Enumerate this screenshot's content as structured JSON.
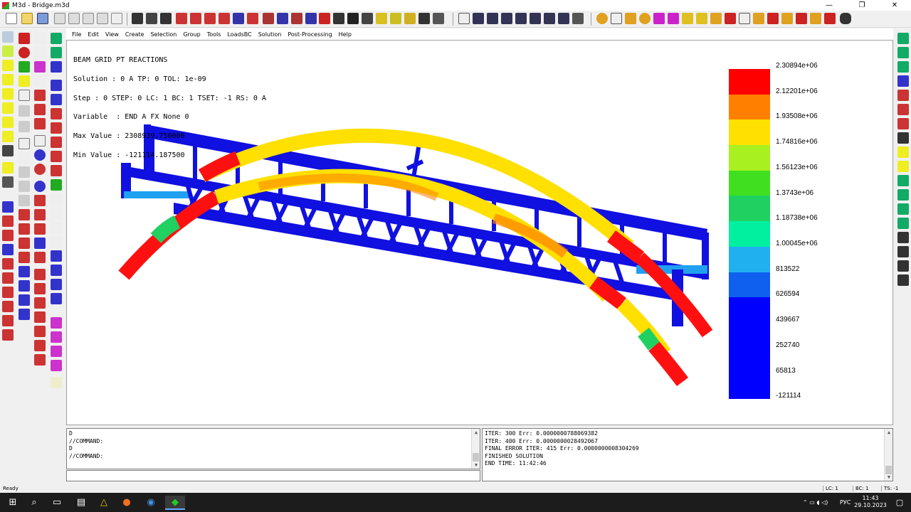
{
  "window": {
    "title": "M3d - Bridge.m3d",
    "controls": {
      "minimize": "—",
      "maximize": "❐",
      "close": "✕"
    }
  },
  "menu": [
    "File",
    "Edit",
    "View",
    "Create",
    "Selection",
    "Group",
    "Tools",
    "LoadsBC",
    "Solution",
    "Post-Processing",
    "Help"
  ],
  "viewport": {
    "info_lines": [
      "BEAM GRID PT REACTIONS",
      "Solution : 0 A TP: 0 TOL: 1e-09",
      "Step : 0 STEP: 0 LC: 1 BC: 1 TSET: -1 RS: 0 A",
      "Variable  : END A FX None 0",
      "Max Value : 2308939.750000",
      "Min Value : -121114.187500"
    ],
    "legend": {
      "colors": [
        "#ff0000",
        "#ff8000",
        "#ffe000",
        "#a8f020",
        "#40e020",
        "#20d060",
        "#00f0a0",
        "#20b0f0",
        "#1060f0",
        "#0000ff"
      ],
      "labels": [
        "2.30894e+06",
        "2.12201e+06",
        "1.93508e+06",
        "1.74816e+06",
        "1.56123e+06",
        "1.3743e+06",
        "1.18738e+06",
        "1.00045e+06",
        "813522",
        "626594",
        "439667",
        "252740",
        "65813",
        "-121114"
      ]
    }
  },
  "command_pane": {
    "lines": [
      "D",
      "//COMMAND:",
      "D",
      "//COMMAND:"
    ],
    "input_value": ""
  },
  "log_pane": {
    "lines": [
      "ITER: 300 Err: 0.0000000788069382",
      "ITER: 400 Err: 0.0000000028492067",
      "FINAL ERROR ITER: 415 Err: 0.0000000008304269",
      "FINISHED SOLUTION",
      "END TIME:  11:42:46"
    ]
  },
  "statusbar": {
    "status": "Ready",
    "lc": "LC: 1",
    "bc": "BC: 1",
    "ts": "TS: -1"
  },
  "taskbar": {
    "language": "РУС",
    "time": "11:43",
    "date": "29.10.2023"
  }
}
